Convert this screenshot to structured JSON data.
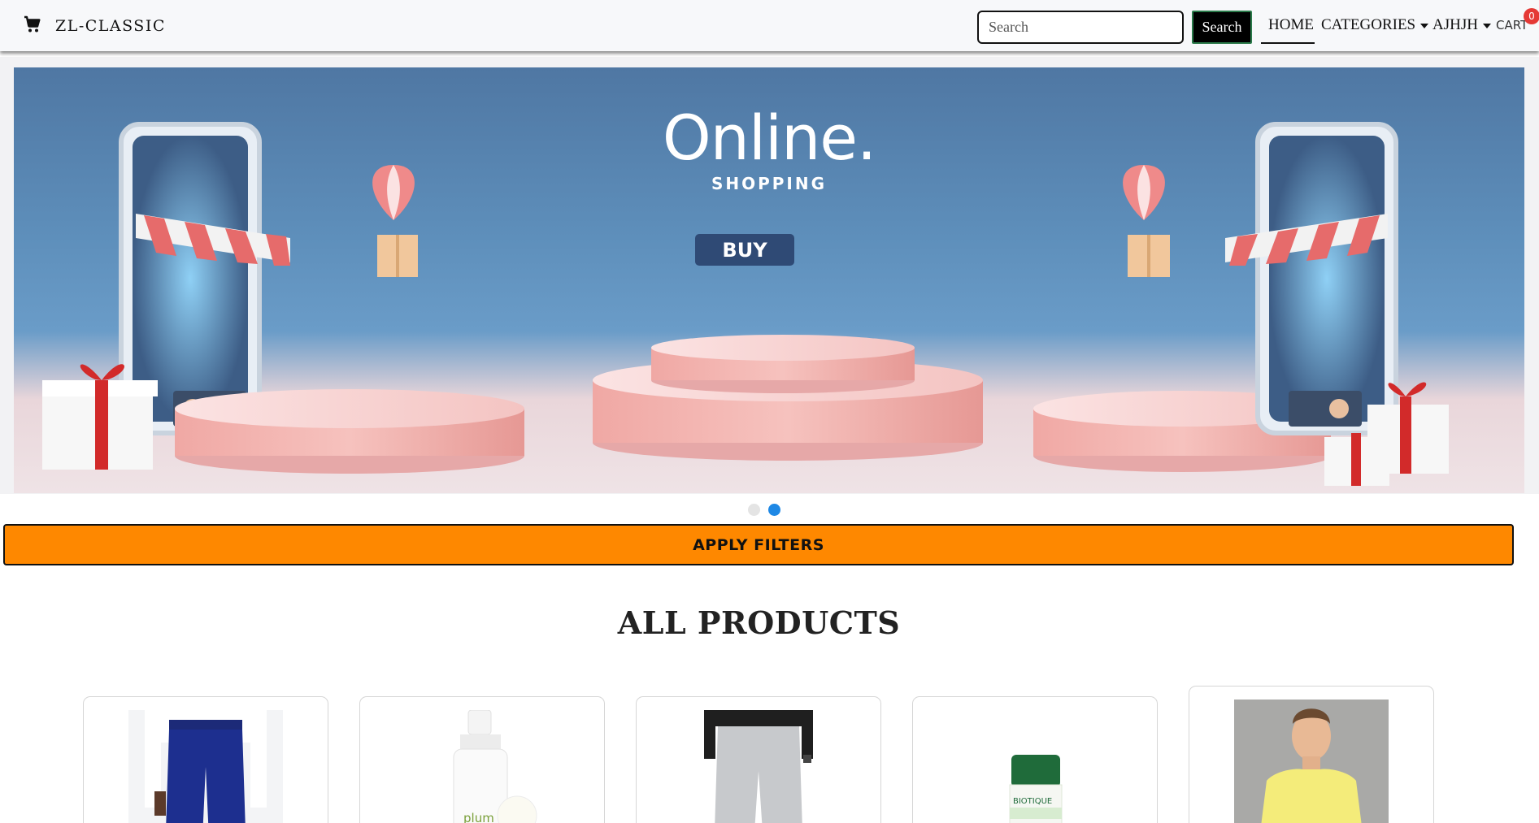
{
  "navbar": {
    "brand": "ZL-CLASSIC",
    "brand_icon": "cart-icon",
    "search_placeholder": "Search",
    "search_button": "Search",
    "links": {
      "home": "HOME",
      "categories": "CATEGORIES",
      "user": "AJHJH",
      "cart": "CART"
    },
    "cart_count": "0"
  },
  "carousel": {
    "title": "Online.",
    "subtitle": "SHOPPING",
    "button": "BUY",
    "slides": 2,
    "active_slide": 2
  },
  "filters": {
    "apply_label": "APPLY FILTERS"
  },
  "products_section": {
    "title": "ALL PRODUCTS",
    "products": [
      {
        "kind": "blue-trousers"
      },
      {
        "kind": "skincare-bottle"
      },
      {
        "kind": "grey-trousers"
      },
      {
        "kind": "green-bottle"
      },
      {
        "kind": "yellow-tshirt"
      }
    ]
  },
  "colors": {
    "accent_orange": "#fe8800",
    "dot_active": "#1e88e5",
    "badge_red": "#e53935"
  }
}
